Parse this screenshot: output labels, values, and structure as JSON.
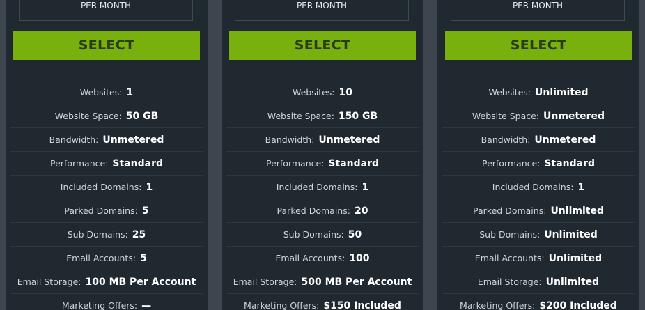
{
  "plans": [
    {
      "price_period": "PER MONTH",
      "select_label": "SELECT",
      "features": [
        {
          "label": "Websites:",
          "value": "1"
        },
        {
          "label": "Website Space:",
          "value": "50 GB"
        },
        {
          "label": "Bandwidth:",
          "value": "Unmetered"
        },
        {
          "label": "Performance:",
          "value": "Standard"
        },
        {
          "label": "Included Domains:",
          "value": "1"
        },
        {
          "label": "Parked Domains:",
          "value": "5"
        },
        {
          "label": "Sub Domains:",
          "value": "25"
        },
        {
          "label": "Email Accounts:",
          "value": "5"
        },
        {
          "label": "Email Storage:",
          "value": "100 MB Per Account"
        },
        {
          "label": "Marketing Offers:",
          "value": "—"
        }
      ]
    },
    {
      "price_period": "PER MONTH",
      "select_label": "SELECT",
      "features": [
        {
          "label": "Websites:",
          "value": "10"
        },
        {
          "label": "Website Space:",
          "value": "150 GB"
        },
        {
          "label": "Bandwidth:",
          "value": "Unmetered"
        },
        {
          "label": "Performance:",
          "value": "Standard"
        },
        {
          "label": "Included Domains:",
          "value": "1"
        },
        {
          "label": "Parked Domains:",
          "value": "20"
        },
        {
          "label": "Sub Domains:",
          "value": "50"
        },
        {
          "label": "Email Accounts:",
          "value": "100"
        },
        {
          "label": "Email Storage:",
          "value": "500 MB Per Account"
        },
        {
          "label": "Marketing Offers:",
          "value": "$150 Included"
        }
      ]
    },
    {
      "price_period": "PER MONTH",
      "select_label": "SELECT",
      "features": [
        {
          "label": "Websites:",
          "value": "Unlimited"
        },
        {
          "label": "Website Space:",
          "value": "Unmetered"
        },
        {
          "label": "Bandwidth:",
          "value": "Unmetered"
        },
        {
          "label": "Performance:",
          "value": "Standard"
        },
        {
          "label": "Included Domains:",
          "value": "1"
        },
        {
          "label": "Parked Domains:",
          "value": "Unlimited"
        },
        {
          "label": "Sub Domains:",
          "value": "Unlimited"
        },
        {
          "label": "Email Accounts:",
          "value": "Unlimited"
        },
        {
          "label": "Email Storage:",
          "value": "Unlimited"
        },
        {
          "label": "Marketing Offers:",
          "value": "$200 Included"
        }
      ]
    }
  ],
  "colors": {
    "background": "#3d464e",
    "card": "#212930",
    "select_button": "#78b10d",
    "select_text": "#2c3a17"
  }
}
